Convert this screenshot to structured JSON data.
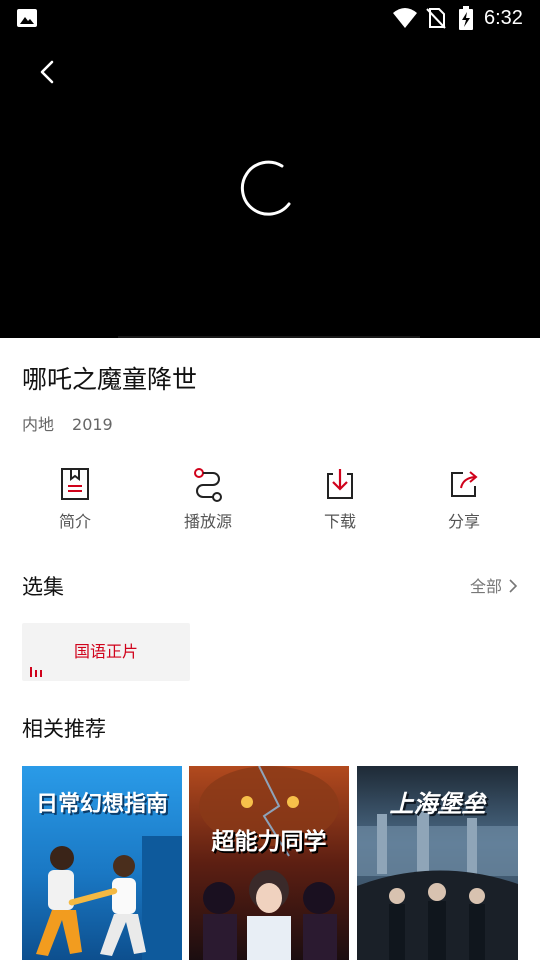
{
  "status_bar": {
    "time": "6:32",
    "icons": [
      "gallery-icon",
      "wifi-icon",
      "no-sim-icon",
      "battery-charging-icon"
    ]
  },
  "player": {
    "back_icon": "chevron-left-icon",
    "loading_icon": "spinner-icon"
  },
  "movie": {
    "title": "哪吒之魔童降世",
    "region": "内地",
    "year": "2019"
  },
  "actions": [
    {
      "label": "简介",
      "icon": "book-icon"
    },
    {
      "label": "播放源",
      "icon": "route-icon"
    },
    {
      "label": "下载",
      "icon": "download-icon"
    },
    {
      "label": "分享",
      "icon": "share-icon"
    }
  ],
  "episodes": {
    "heading": "选集",
    "more_label": "全部",
    "items": [
      {
        "label": "国语正片",
        "active": true
      }
    ]
  },
  "recommend": {
    "heading": "相关推荐",
    "items": [
      {
        "title": "日常幻想指南",
        "accent": "#1f8ad6"
      },
      {
        "title": "超能力同学",
        "accent": "#c0392b"
      },
      {
        "title": "上海堡垒",
        "accent": "#4b6a86"
      }
    ]
  },
  "colors": {
    "accent_red": "#d0021b"
  }
}
